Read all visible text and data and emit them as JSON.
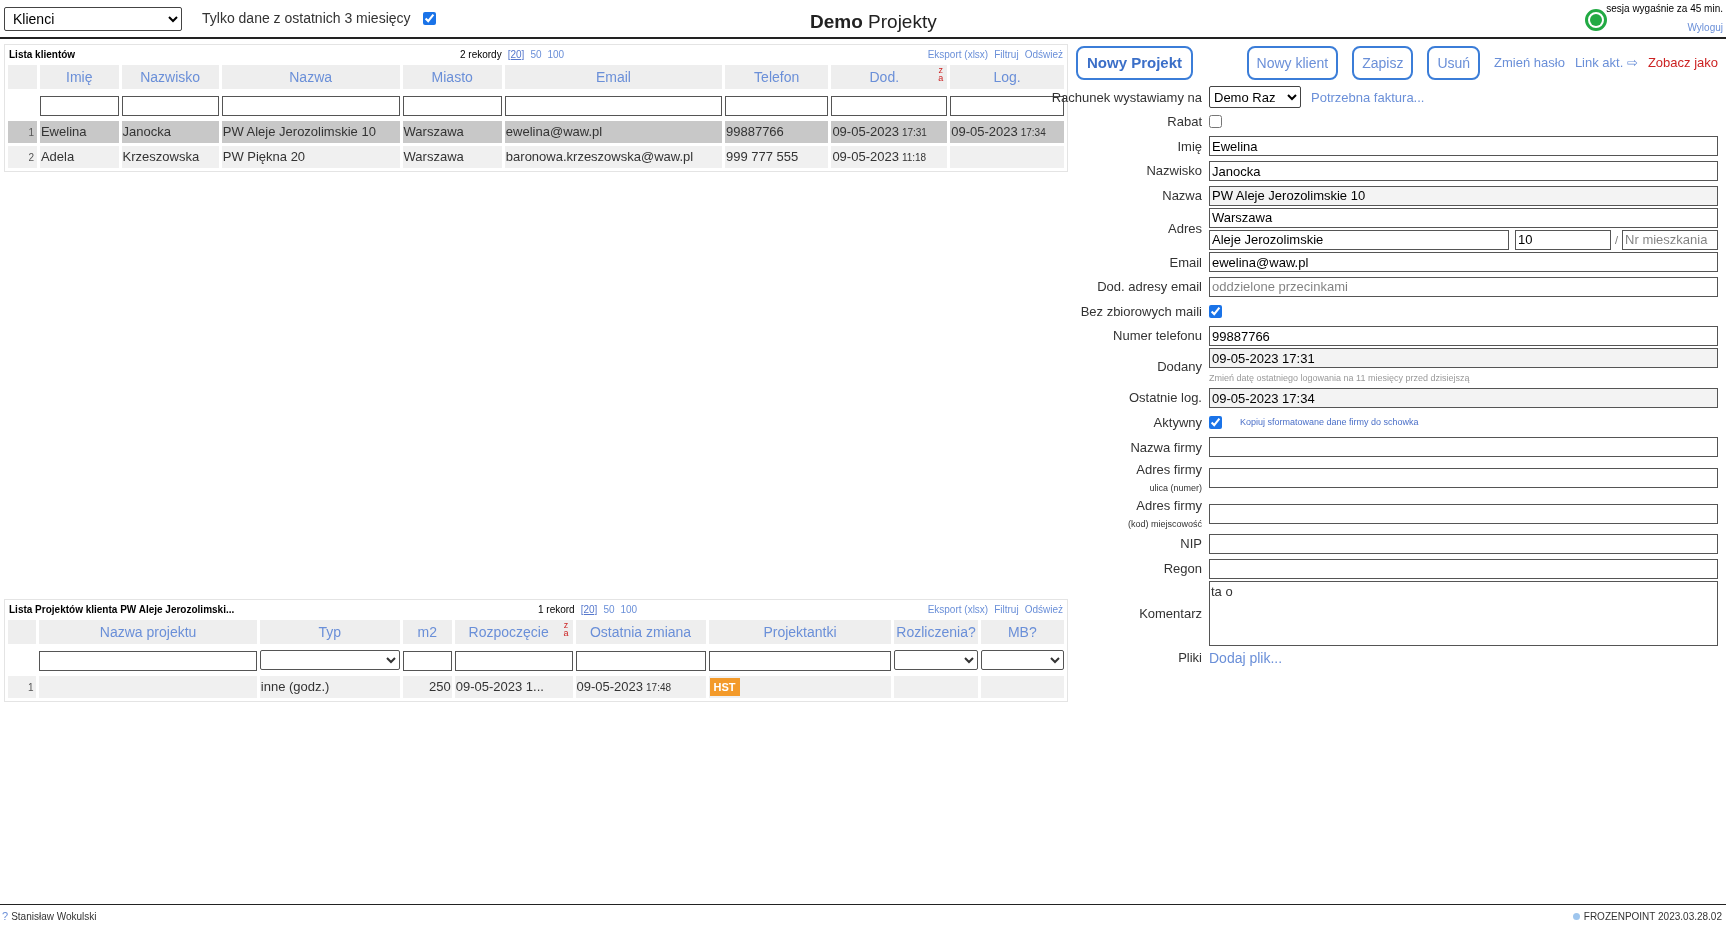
{
  "header": {
    "view_select": "Klienci",
    "filter_label": "Tylko dane z ostatnich 3 miesięcy",
    "filter_checked": true,
    "title_bold": "Demo",
    "title_rest": "Projekty",
    "session": "sesja wygaśnie za 45 min.",
    "logout": "Wyloguj"
  },
  "clients": {
    "title": "Lista klientów",
    "count": "2 rekordy",
    "page_sizes": [
      {
        "label": "[20]",
        "selected": true
      },
      {
        "label": "50",
        "selected": false
      },
      {
        "label": "100",
        "selected": false
      }
    ],
    "actions": [
      "Eksport (xlsx)",
      "Filtruj",
      "Odśwież"
    ],
    "columns": [
      {
        "label": "Imię",
        "kind": "text"
      },
      {
        "label": "Nazwisko",
        "kind": "text"
      },
      {
        "label": "Nazwa",
        "kind": "text"
      },
      {
        "label": "Miasto",
        "kind": "text"
      },
      {
        "label": "Email",
        "kind": "text"
      },
      {
        "label": "Telefon",
        "kind": "text"
      },
      {
        "label": "Dod.",
        "kind": "text",
        "sort": [
          "z",
          "a"
        ]
      },
      {
        "label": "Log.",
        "kind": "text"
      }
    ],
    "rows": [
      {
        "num": "1",
        "selected": true,
        "cells": [
          {
            "text": "Ewelina"
          },
          {
            "text": "Janocka"
          },
          {
            "text": "PW Aleje Jerozolimskie 10"
          },
          {
            "text": "Warszawa"
          },
          {
            "text": "ewelina@waw.pl"
          },
          {
            "text": "99887766"
          },
          {
            "text": "09-05-2023",
            "small": "17:31"
          },
          {
            "text": "09-05-2023",
            "small": "17:34"
          }
        ]
      },
      {
        "num": "2",
        "selected": false,
        "cells": [
          {
            "text": "Adela"
          },
          {
            "text": "Krzeszowska"
          },
          {
            "text": "PW Piękna 20"
          },
          {
            "text": "Warszawa"
          },
          {
            "text": "baronowa.krzeszowska@waw.pl"
          },
          {
            "text": "999 777 555"
          },
          {
            "text": "09-05-2023",
            "small": "11:18"
          },
          {
            "text": ""
          }
        ]
      }
    ]
  },
  "projects": {
    "title": "Lista Projektów klienta PW Aleje Jerozolimski...",
    "count": "1 rekord",
    "page_sizes": [
      {
        "label": "[20]",
        "selected": true
      },
      {
        "label": "50",
        "selected": false
      },
      {
        "label": "100",
        "selected": false
      }
    ],
    "actions": [
      "Eksport (xlsx)",
      "Filtruj",
      "Odśwież"
    ],
    "columns": [
      {
        "label": "Nazwa projektu",
        "kind": "text"
      },
      {
        "label": "Typ",
        "kind": "select"
      },
      {
        "label": "m2",
        "kind": "text"
      },
      {
        "label": "Rozpoczęcie",
        "kind": "text",
        "sort": [
          "z",
          "a"
        ]
      },
      {
        "label": "Ostatnia zmiana",
        "kind": "text"
      },
      {
        "label": "Projektantki",
        "kind": "text"
      },
      {
        "label": "Rozliczenia?",
        "kind": "select"
      },
      {
        "label": "MB?",
        "kind": "select"
      }
    ],
    "rows": [
      {
        "num": "1",
        "selected": false,
        "cells": [
          {
            "text": ""
          },
          {
            "text": "inne (godz.)"
          },
          {
            "text": "250",
            "kind": "number"
          },
          {
            "text": "09-05-2023 1..."
          },
          {
            "text": "09-05-2023",
            "small": "17:48"
          },
          {
            "text": "HST",
            "kind": "badge"
          },
          {
            "text": ""
          },
          {
            "text": ""
          }
        ]
      }
    ]
  },
  "toolbar": [
    {
      "label": "Nowy Projekt",
      "kind": "primary"
    },
    {
      "label": "Nowy klient",
      "kind": "button"
    },
    {
      "label": "Zapisz",
      "kind": "button"
    },
    {
      "label": "Usuń",
      "kind": "button"
    },
    {
      "label": "Zmień hasło",
      "kind": "link"
    },
    {
      "label": "Link akt. ⇨",
      "kind": "link"
    },
    {
      "label": "Zobacz jako",
      "kind": "danger"
    }
  ],
  "form": [
    {
      "kind": "select",
      "label": "Rachunek wystawiamy na",
      "value": "Demo Raz",
      "link": "Potrzebna faktura..."
    },
    {
      "kind": "checkbox",
      "label": "Rabat",
      "checked": false
    },
    {
      "kind": "text",
      "label": "Imię",
      "value": "Ewelina",
      "readonly": false
    },
    {
      "kind": "text",
      "label": "Nazwisko",
      "value": "Janocka",
      "readonly": false
    },
    {
      "kind": "text",
      "label": "Nazwa",
      "value": "PW Aleje Jerozolimskie 10",
      "readonly": true
    },
    {
      "kind": "address",
      "label": "Adres",
      "city": "Warszawa",
      "street": "Aleje Jerozolimskie",
      "number": "10",
      "separator": "/",
      "flat_placeholder": "Nr mieszkania"
    },
    {
      "kind": "text",
      "label": "Email",
      "value": "ewelina@waw.pl",
      "readonly": false
    },
    {
      "kind": "text",
      "label": "Dod. adresy email",
      "placeholder": "oddzielone przecinkami",
      "readonly": false
    },
    {
      "kind": "checkbox",
      "label": "Bez zbiorowych maili",
      "checked": true
    },
    {
      "kind": "text",
      "label": "Numer telefonu",
      "value": "99887766",
      "readonly": false
    },
    {
      "kind": "text",
      "label": "Dodany",
      "value": "09-05-2023 17:31",
      "readonly": true,
      "note": "Zmień datę ostatniego logowania na 11 miesięcy przed dzisiejszą"
    },
    {
      "kind": "text",
      "label": "Ostatnie log.",
      "value": "09-05-2023 17:34",
      "readonly": true
    },
    {
      "kind": "checkbox",
      "label": "Aktywny",
      "checked": true,
      "link": "Kopiuj sformatowane dane firmy do schowka"
    },
    {
      "kind": "text",
      "label": "Nazwa firmy",
      "readonly": false
    },
    {
      "kind": "text",
      "label": "Adres firmy",
      "sublabel": "ulica (numer)",
      "readonly": false
    },
    {
      "kind": "text",
      "label": "Adres firmy",
      "sublabel": "(kod) miejscowość",
      "readonly": false
    },
    {
      "kind": "text",
      "label": "NIP",
      "readonly": false
    },
    {
      "kind": "text",
      "label": "Regon",
      "readonly": false
    },
    {
      "kind": "textarea",
      "label": "Komentarz",
      "value": "ta o"
    },
    {
      "kind": "files",
      "label": "Pliki",
      "link": "Dodaj plik..."
    }
  ],
  "footer": {
    "help": "?",
    "user": "Stanisław Wokulski",
    "version": "FROZENPOINT 2023.03.28.02"
  }
}
